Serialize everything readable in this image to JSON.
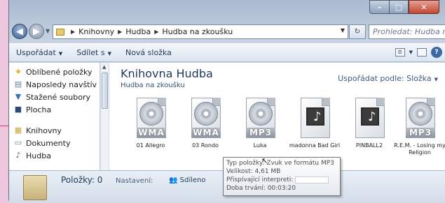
{
  "address": {
    "crumbs": [
      "Knihovny",
      "Hudba",
      "Hudba na zkoušku"
    ],
    "search_placeholder": "Prohledat: Hudba n..."
  },
  "toolbar": {
    "organize": "Uspořádat",
    "share": "Sdílet s",
    "new_folder": "Nová složka"
  },
  "nav": {
    "favorites": "Oblíbené položky",
    "recent": "Naposledy navštív",
    "downloads": "Stažené soubory",
    "desktop": "Plocha",
    "libraries": "Knihovny",
    "documents": "Dokumenty",
    "music": "Hudba"
  },
  "library": {
    "title": "Knihovna Hudba",
    "subtitle": "Hudba na zkoušku",
    "arrange_label": "Uspořádat podle:",
    "arrange_value": "Složka"
  },
  "files": [
    {
      "name": "01 Allegro",
      "format": "WMA"
    },
    {
      "name": "03 Rondo",
      "format": "WMA"
    },
    {
      "name": "Luka",
      "format": "MP3"
    },
    {
      "name": "madonna Bad Girl",
      "format": ""
    },
    {
      "name": "PINBALL2",
      "format": ""
    },
    {
      "name": "R.E.M. - Losing my Religion",
      "format": "MP3"
    }
  ],
  "tooltip": {
    "type": "Typ položky: Zvuk ve formátu MP3",
    "size": "Velikost: 4,61 MB",
    "artists": "Přispívající interpreti:",
    "duration": "Doba trvání: 00:03:20"
  },
  "details": {
    "count": "Položky: 0",
    "setting_label": "Nastavení:",
    "shared": "Sdíleno"
  },
  "colors": {
    "background": "#ecc7dd",
    "pointer": "#d6317a"
  }
}
